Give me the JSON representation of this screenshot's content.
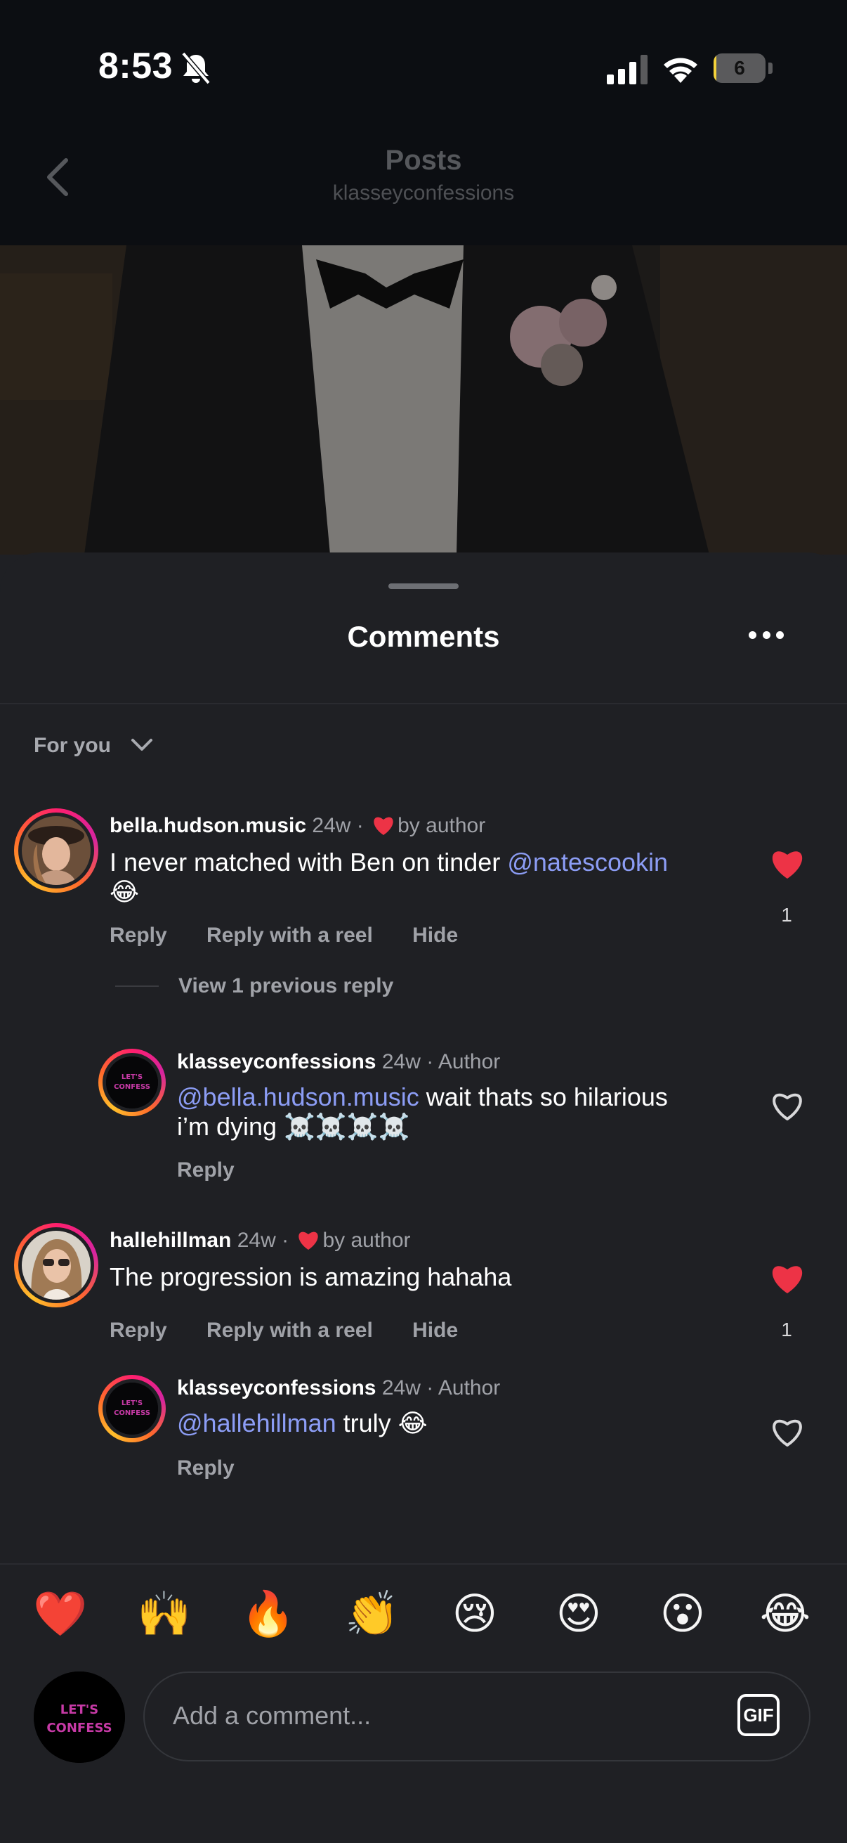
{
  "status_bar": {
    "time": "8:53",
    "battery": "6",
    "battery_fraction": 0.06
  },
  "header": {
    "title": "Posts",
    "subtitle": "klasseyconfessions"
  },
  "sheet": {
    "title": "Comments",
    "sort_label": "For you"
  },
  "comments": [
    {
      "username": "bella.hudson.music",
      "meta": "24w ·",
      "liked_by_author": "by author",
      "mention": "@natescookin",
      "text_a": "I never matched with Ben on tinder",
      "text_b": "😂",
      "actions": [
        "Reply",
        "Reply with a reel",
        "Hide"
      ],
      "likes": "1",
      "liked": true
    },
    {
      "username": "klasseyconfessions",
      "meta": "24w · Author",
      "mention": "@bella.hudson.music",
      "text_a": "wait thats so hilarious",
      "text_b": "i’m dying ☠️☠️☠️☠️",
      "actions": [
        "Reply"
      ],
      "liked": false,
      "is_reply": true
    },
    {
      "username": "hallehillman",
      "meta": "24w ·",
      "liked_by_author": "by author",
      "text_a": "The progression is amazing hahaha",
      "actions": [
        "Reply",
        "Reply with a reel",
        "Hide"
      ],
      "likes": "1",
      "liked": true
    },
    {
      "username": "klasseyconfessions",
      "meta": "24w · Author",
      "mention": "@hallehillman",
      "text_a": "truly 😂",
      "actions": [
        "Reply"
      ],
      "liked": false,
      "is_reply": true
    }
  ],
  "view_replies": "View 1 previous reply",
  "quick_reactions": [
    "❤️",
    "🙌",
    "🔥",
    "👏",
    "😢",
    "😍",
    "😮",
    "😂"
  ],
  "composer": {
    "placeholder": "Add a comment...",
    "gif_label": "GIF"
  },
  "logo_text": "LET'S CONFESS",
  "colors": {
    "background": "#1f2024",
    "accent_like": "#ed3346",
    "mention": "#8c9df5",
    "secondary_text": "#a0a2a8"
  }
}
